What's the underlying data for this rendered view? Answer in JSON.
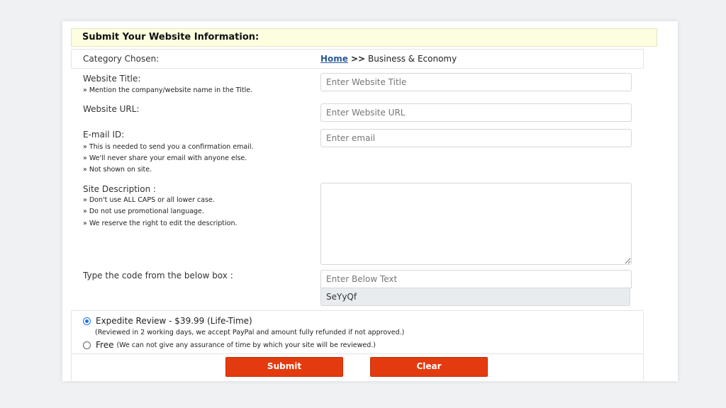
{
  "form": {
    "header": "Submit Your Website Information:",
    "category": {
      "label": "Category Chosen:",
      "home_link": "Home",
      "separator": ">>",
      "path": "Business & Economy"
    },
    "website_title": {
      "label": "Website Title:",
      "notes": [
        "» Mention the company/website name in the Title."
      ],
      "placeholder": "Enter Website Title"
    },
    "website_url": {
      "label": "Website URL:",
      "placeholder": "Enter Website URL"
    },
    "email": {
      "label": "E-mail ID:",
      "notes": [
        "» This is needed to send you a confirmation email.",
        "» We'll never share your email with anyone else.",
        "» Not shown on site."
      ],
      "placeholder": "Enter email"
    },
    "description": {
      "label": "Site Description :",
      "notes": [
        "» Don't use ALL CAPS or all lower case.",
        "» Do not use promotional language.",
        "» We reserve the right to edit the description."
      ],
      "value": ""
    },
    "captcha": {
      "label": "Type the code from the below box :",
      "placeholder": "Enter Below Text",
      "code": "SeYyQf"
    },
    "review_options": [
      {
        "label": "Expedite Review - $39.99 (Life-Time)",
        "detail": "(Reviewed in 2 working days, we accept PayPal and amount fully refunded if not approved.)",
        "selected": true
      },
      {
        "label": "Free",
        "detail": "(We can not give any assurance of time by which your site will be reviewed.)",
        "selected": false
      }
    ],
    "buttons": {
      "submit": "Submit",
      "clear": "Clear"
    }
  },
  "colors": {
    "header_bg": "#fdfde0",
    "button_bg": "#e33b0f",
    "link": "#2a5a94",
    "radio_accent": "#1a73e8"
  }
}
